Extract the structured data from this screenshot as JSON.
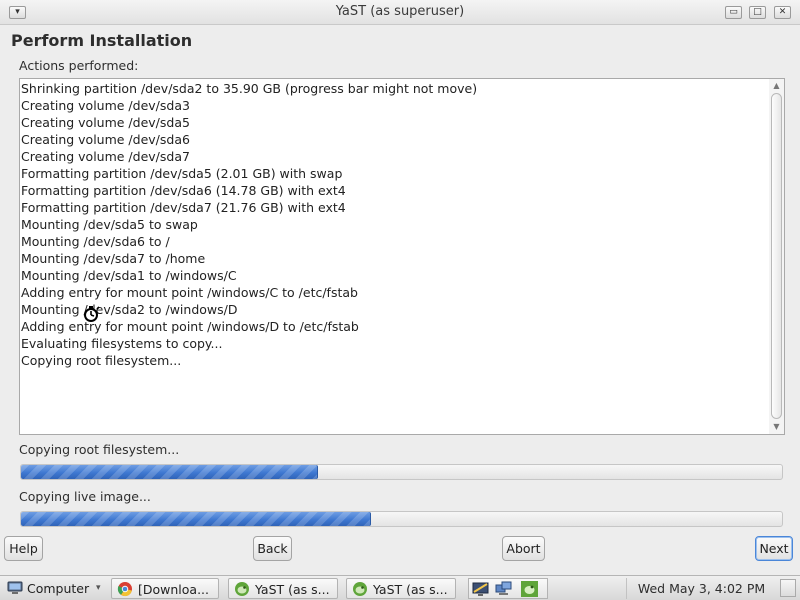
{
  "window": {
    "title": "YaST (as superuser)",
    "menu_glyph": "▾",
    "minimize_glyph": "▭",
    "maximize_glyph": "□",
    "close_glyph": "✕"
  },
  "page": {
    "heading": "Perform Installation",
    "actions_label": "Actions performed:"
  },
  "log": [
    "Shrinking partition /dev/sda2 to 35.90 GB (progress bar might not move)",
    "Creating volume /dev/sda3",
    "Creating volume /dev/sda5",
    "Creating volume /dev/sda6",
    "Creating volume /dev/sda7",
    "Formatting partition /dev/sda5 (2.01 GB) with swap",
    "Formatting partition /dev/sda6 (14.78 GB) with ext4",
    "Formatting partition /dev/sda7 (21.76 GB) with ext4",
    "Mounting /dev/sda5 to swap",
    "Mounting /dev/sda6 to /",
    "Mounting /dev/sda7 to /home",
    "Mounting /dev/sda1 to /windows/C",
    "Adding entry for mount point /windows/C to /etc/fstab",
    "Mounting /dev/sda2 to /windows/D",
    "Adding entry for mount point /windows/D to /etc/fstab",
    "Evaluating filesystems to copy...",
    "Copying root filesystem..."
  ],
  "progress": [
    {
      "label": "Copying root filesystem...",
      "fraction": 0.39
    },
    {
      "label": "Copying live image...",
      "fraction": 0.46
    }
  ],
  "buttons": {
    "help": "Help",
    "back": "Back",
    "abort": "Abort",
    "next": "Next"
  },
  "taskbar": {
    "start_label": "Computer",
    "tasks": [
      "[Downloa...",
      "YaST (as s...",
      "YaST (as s..."
    ],
    "clock": "Wed May  3,  4:02 PM"
  },
  "colors": {
    "progress_fill": "#3f78d1",
    "focus_border": "#4a86d8"
  }
}
